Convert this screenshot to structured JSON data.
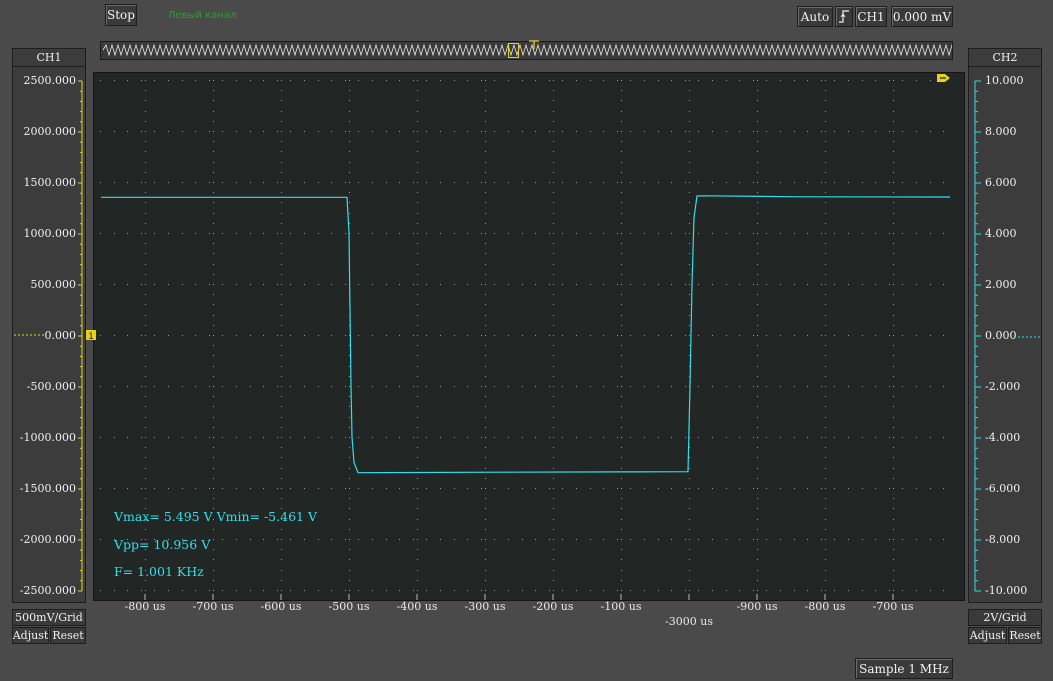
{
  "toolbar": {
    "stop_label": "Stop",
    "mode_label": "Левый канал",
    "trigger_mode": "Auto",
    "trigger_channel": "CH1",
    "trigger_level": "0.000 mV"
  },
  "left_panel": {
    "title": "CH1",
    "scale": "500mV/Grid",
    "adjust_label": "Adjust",
    "reset_label": "Reset",
    "y_labels": [
      "2500.000",
      "2000.000",
      "1500.000",
      "1000.000",
      "500.000",
      "0.000",
      "-500.000",
      "-1000.000",
      "-1500.000",
      "-2000.000",
      "-2500.000"
    ]
  },
  "right_panel": {
    "title": "CH2",
    "scale": "2V/Grid",
    "adjust_label": "Adjust",
    "reset_label": "Reset",
    "y_labels": [
      "10.000",
      "8.000",
      "6.000",
      "4.000",
      "2.000",
      "0.000",
      "-2.000",
      "-4.000",
      "-6.000",
      "-8.000",
      "-10.000"
    ]
  },
  "x_axis": {
    "labels": [
      "-800 us",
      "-700 us",
      "-600 us",
      "-500 us",
      "-400 us",
      "-300 us",
      "-200 us",
      "-100 us",
      "",
      "-900 us",
      "-800 us",
      "-700 us"
    ],
    "offset_label": "-3000 us"
  },
  "measurements": {
    "vmax_vmin": "Vmax= 5.495 V  Vmin= -5.461 V",
    "vpp": "Vpp= 10.956 V",
    "freq": "F= 1.001 KHz"
  },
  "status": {
    "sample_rate": "Sample 1 MHz"
  },
  "colors": {
    "trace": "#2fe0ea",
    "ch1_marker": "#e6d21c",
    "grid_dots": "#9a9a9a"
  },
  "chart_data": {
    "type": "line",
    "title": "",
    "xlabel": "",
    "ylabel": "",
    "grid": true,
    "x_unit": "us",
    "xlim": [
      -850,
      -725
    ],
    "y_unit": "V",
    "ylim": [
      -10,
      10
    ],
    "series": [
      {
        "x": [
          -850,
          -500,
          -495,
          -490,
          -485,
          -480,
          -440,
          -300,
          -200,
          -100,
          0,
          -10,
          -15,
          -20,
          -875,
          -870,
          -800,
          -725
        ],
        "y": [
          5.4,
          5.4,
          0,
          -4.5,
          -5.3,
          -5.4,
          -5.4,
          -5.38,
          -5.37,
          -5.36,
          -5.35,
          0,
          4.8,
          5.45,
          5.45,
          5.42,
          5.4,
          5.4
        ]
      }
    ]
  }
}
